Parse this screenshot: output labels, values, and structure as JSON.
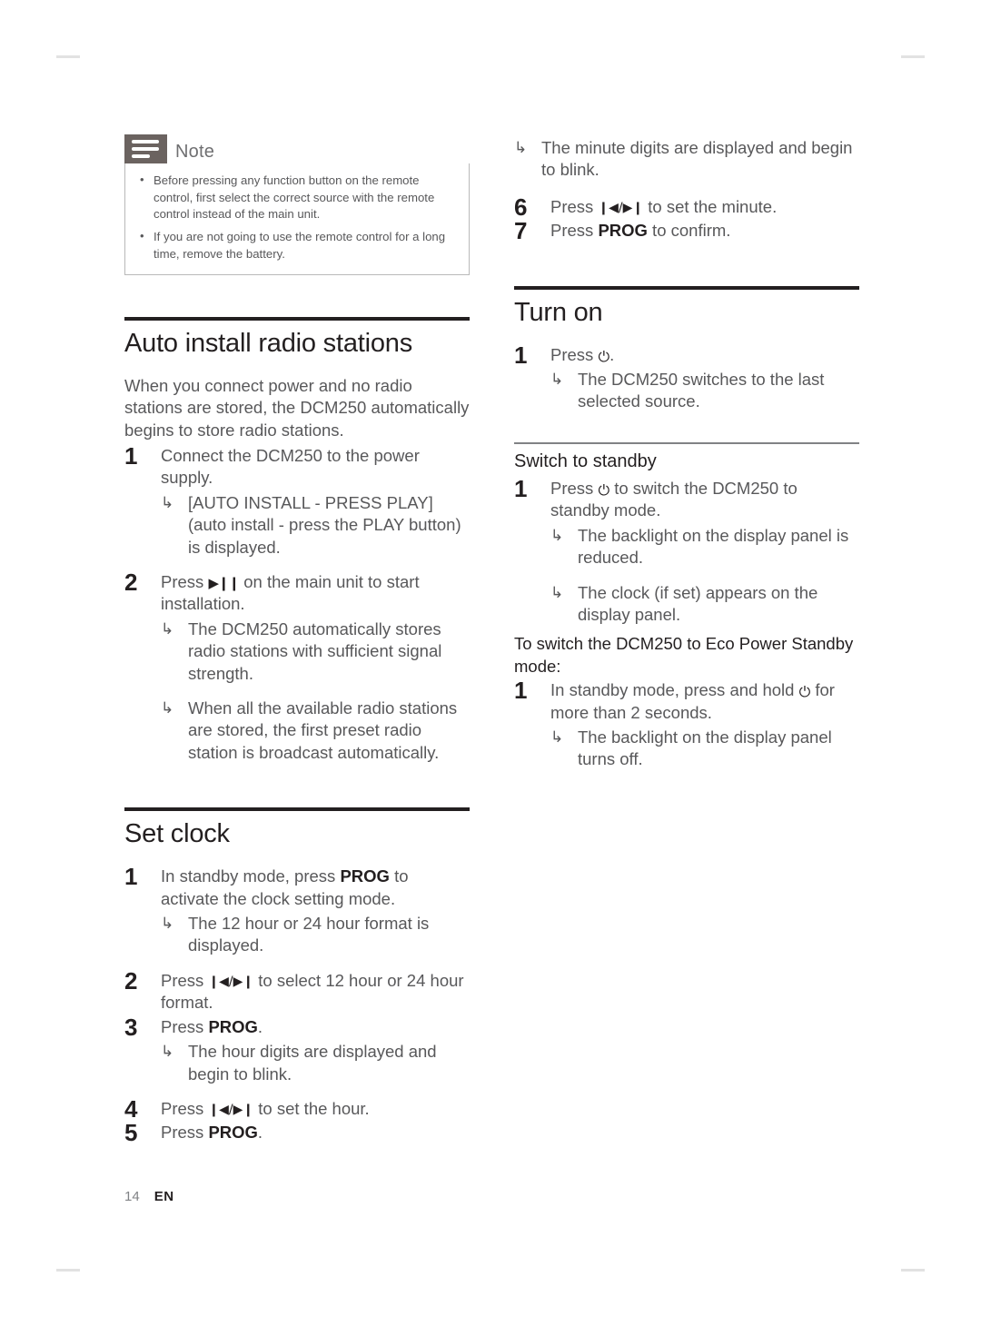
{
  "page": {
    "number": "14",
    "language": "EN"
  },
  "note": {
    "title": "Note",
    "icon": "note-lines-icon",
    "items": [
      "Before pressing any function button on the remote control, first select the correct source with the remote control instead of the main unit.",
      "If you are not going to use the remote control for a long time, remove the battery."
    ]
  },
  "icons": {
    "play_pause": "▶❙❙",
    "skip_prev_next": "❙◀/▶❙",
    "power": "⏻",
    "result_arrow": "↳"
  },
  "left_column": {
    "auto_install": {
      "title": "Auto install radio stations",
      "intro": "When you connect power and no radio stations are stored, the DCM250 automatically begins to store radio stations.",
      "steps": [
        {
          "num": "1",
          "text_before": "Connect the DCM250 to the power supply.",
          "results": [
            "[AUTO INSTALL - PRESS PLAY] (auto install - press the PLAY button) is displayed."
          ]
        },
        {
          "num": "2",
          "text_before": "Press ",
          "text_after": " on the main unit to start installation.",
          "results": [
            "The DCM250 automatically stores radio stations with sufficient signal strength.",
            "When all the available radio stations are stored, the first preset radio station is broadcast automatically."
          ]
        }
      ]
    },
    "set_clock": {
      "title": "Set clock",
      "steps": [
        {
          "num": "1",
          "text_before": "In standby mode, press ",
          "bold": "PROG",
          "text_after": " to activate the clock setting mode.",
          "results": [
            "The 12 hour or 24 hour format is displayed."
          ]
        },
        {
          "num": "2",
          "text_before": "Press ",
          "text_after": " to select 12 hour or 24 hour format.",
          "results": []
        },
        {
          "num": "3",
          "text_before": "Press ",
          "bold": "PROG",
          "text_after": ".",
          "results": [
            "The hour digits are displayed and begin to blink."
          ]
        },
        {
          "num": "4",
          "text_before": "Press ",
          "text_after": " to set the hour.",
          "results": []
        },
        {
          "num": "5",
          "text_before": "Press ",
          "bold": "PROG",
          "text_after": ".",
          "results": []
        }
      ]
    }
  },
  "right_column": {
    "set_clock_continued": {
      "leading_results": [
        "The minute digits are displayed and begin to blink."
      ],
      "steps": [
        {
          "num": "6",
          "text_before": "Press ",
          "text_after": " to set the minute.",
          "results": []
        },
        {
          "num": "7",
          "text_before": "Press ",
          "bold": "PROG",
          "text_after": " to confirm.",
          "results": []
        }
      ]
    },
    "turn_on": {
      "title": "Turn on",
      "steps": [
        {
          "num": "1",
          "text_before": "Press ",
          "text_after": ".",
          "results": [
            "The DCM250 switches to the last selected source."
          ]
        }
      ]
    },
    "switch_to_standby": {
      "title": "Switch to standby",
      "steps": [
        {
          "num": "1",
          "text_before": "Press ",
          "text_after": " to switch the DCM250 to standby mode.",
          "results": [
            "The backlight on the display panel is reduced.",
            "The clock (if set) appears on the display panel."
          ]
        }
      ],
      "eco_lead": "To switch the DCM250 to Eco Power Standby mode:",
      "eco_steps": [
        {
          "num": "1",
          "text_before": "In standby mode, press and hold ",
          "text_after": " for more than 2 seconds.",
          "results": [
            "The backlight on the display panel turns off."
          ]
        }
      ]
    }
  }
}
